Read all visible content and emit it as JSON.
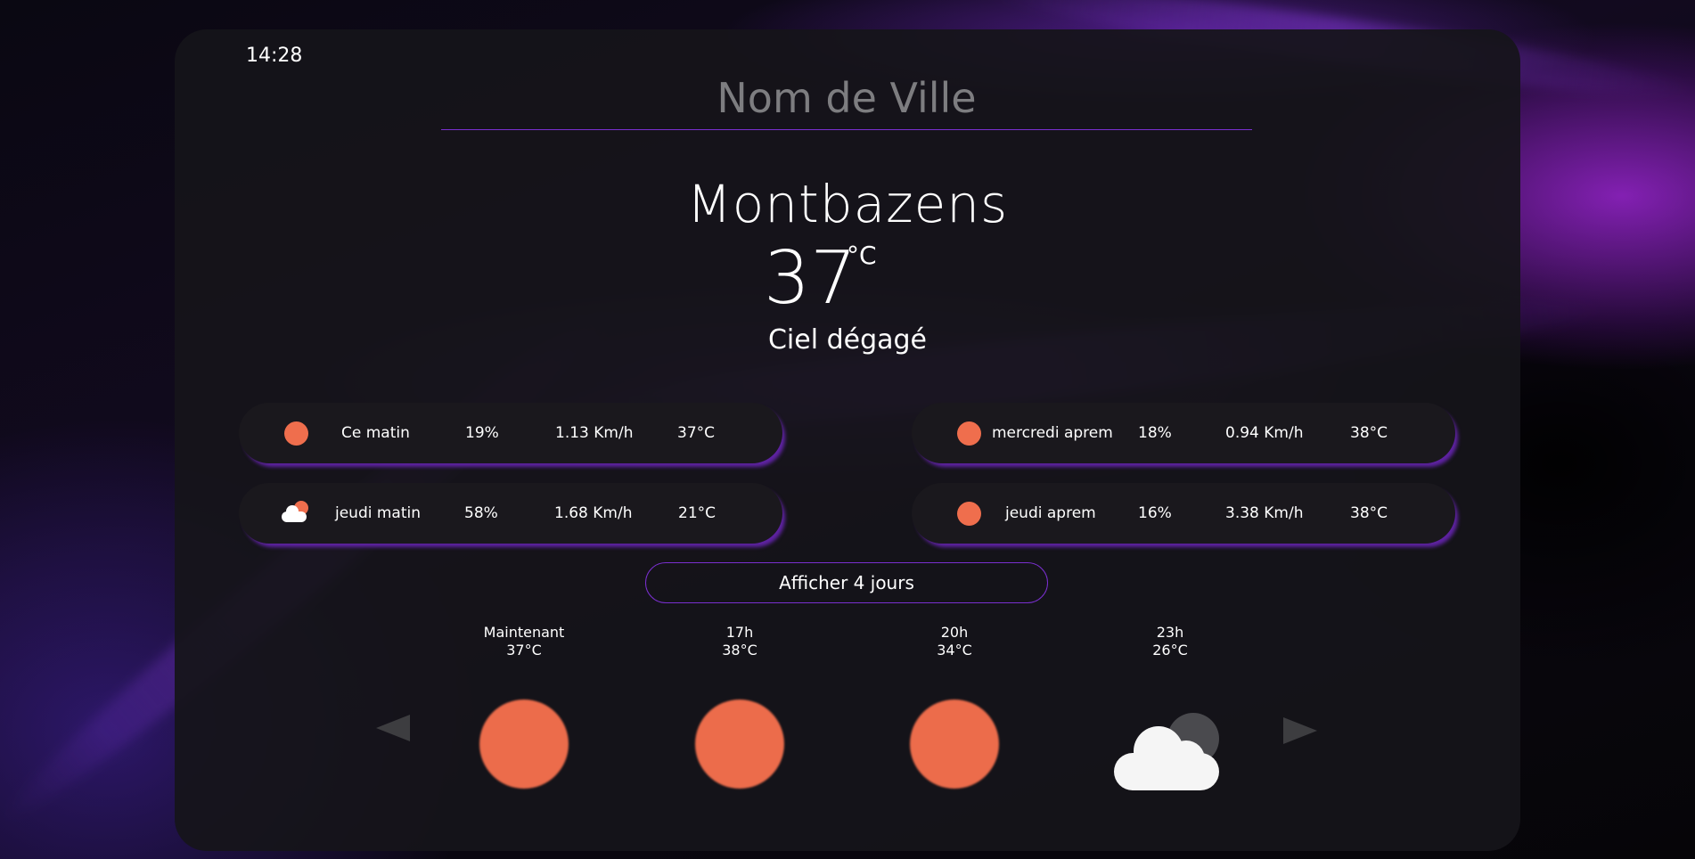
{
  "clock": "14:28",
  "search": {
    "placeholder": "Nom de Ville"
  },
  "current": {
    "city": "Montbazens",
    "temperature": "37",
    "unit": "°C",
    "condition": "Ciel dégagé"
  },
  "periods": [
    {
      "icon": "sun-icon",
      "label": "Ce matin",
      "humidity": "19%",
      "wind": "1.13 Km/h",
      "temp": "37°C"
    },
    {
      "icon": "sun-icon",
      "label": "mercredi aprem",
      "humidity": "18%",
      "wind": "0.94 Km/h",
      "temp": "38°C"
    },
    {
      "icon": "partly-cloudy-icon",
      "label": "jeudi matin",
      "humidity": "58%",
      "wind": "1.68 Km/h",
      "temp": "21°C"
    },
    {
      "icon": "sun-icon",
      "label": "jeudi aprem",
      "humidity": "16%",
      "wind": "3.38 Km/h",
      "temp": "38°C"
    }
  ],
  "show_days_button": "Afficher 4 jours",
  "hourly": [
    {
      "time": "Maintenant",
      "temp": "37°C",
      "icon": "sun-icon"
    },
    {
      "time": "17h",
      "temp": "38°C",
      "icon": "sun-icon"
    },
    {
      "time": "20h",
      "temp": "34°C",
      "icon": "sun-icon"
    },
    {
      "time": "23h",
      "temp": "26°C",
      "icon": "cloud-night-icon"
    }
  ],
  "colors": {
    "accent": "#7a2fd0",
    "sun": "#ef6e4d",
    "panel": "#16141a"
  }
}
